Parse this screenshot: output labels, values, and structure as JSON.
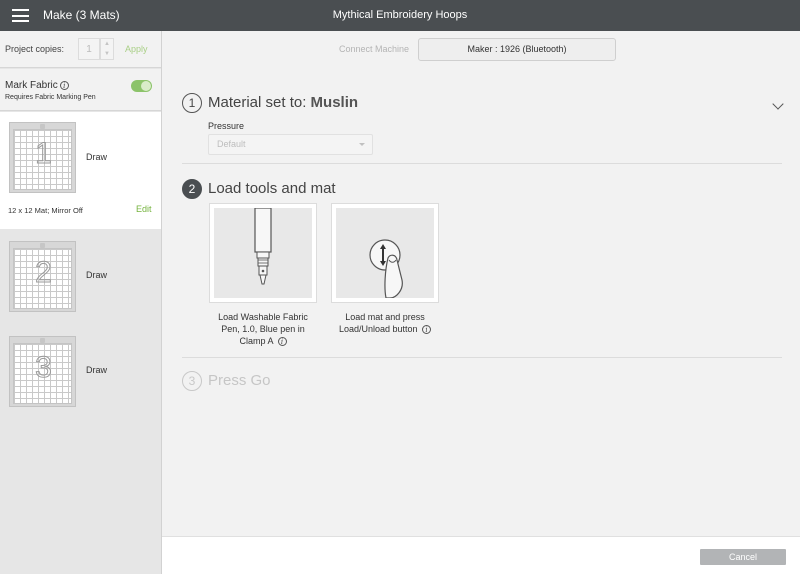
{
  "header": {
    "title": "Make (3 Mats)",
    "project_name": "Mythical Embroidery Hoops"
  },
  "sidebar": {
    "copies_label": "Project copies:",
    "copies_value": "1",
    "apply_label": "Apply",
    "mark_fabric_label": "Mark Fabric",
    "mark_fabric_sub": "Requires Fabric Marking Pen",
    "mark_fabric_on": true,
    "mats": [
      {
        "number": "1",
        "label": "Draw",
        "info": "12 x 12 Mat; Mirror Off",
        "edit_label": "Edit",
        "selected": true
      },
      {
        "number": "2",
        "label": "Draw"
      },
      {
        "number": "3",
        "label": "Draw"
      }
    ]
  },
  "main": {
    "connect_label": "Connect Machine",
    "machine_name": "Maker : 1926 (Bluetooth)",
    "steps": [
      {
        "number": "1",
        "title_prefix": "Material set to: ",
        "material": "Muslin"
      },
      {
        "number": "2",
        "title": "Load tools and mat"
      },
      {
        "number": "3",
        "title": "Press Go"
      }
    ],
    "pressure_label": "Pressure",
    "pressure_value": "Default",
    "cards": [
      {
        "caption_line1": "Load Washable Fabric",
        "caption_line2": "Pen, 1.0, Blue pen in",
        "caption_line3": "Clamp A"
      },
      {
        "caption_line1": "Load mat and press",
        "caption_line2": "Load/Unload button"
      }
    ]
  },
  "footer": {
    "cancel_label": "Cancel"
  },
  "colors": {
    "topbar": "#4a4e51",
    "accent_green": "#8cc36a",
    "edit_green": "#75b33e",
    "cancel_gray": "#b2b4b6"
  }
}
